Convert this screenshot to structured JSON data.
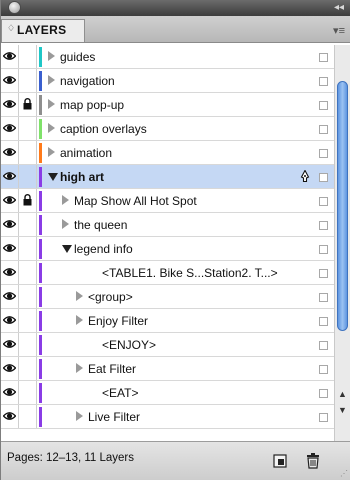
{
  "panel": {
    "tab_label": "LAYERS",
    "tab_arrows": "♢",
    "menu_icon": "▾≡",
    "collapse_icon": "◂◂"
  },
  "colors": {
    "selected_row": "#c5d8f4",
    "scroll_thumb": "#6b9fe6"
  },
  "rows": [
    {
      "name": "guides",
      "level": 0,
      "expand": "right",
      "eye": true,
      "lock": false,
      "color": "#1fc7c7",
      "bold": false,
      "selected": false,
      "pen": false
    },
    {
      "name": "navigation",
      "level": 0,
      "expand": "right",
      "eye": true,
      "lock": false,
      "color": "#3a5fcf",
      "bold": false,
      "selected": false,
      "pen": false
    },
    {
      "name": "map pop-up",
      "level": 0,
      "expand": "right",
      "eye": true,
      "lock": true,
      "color": "#8e8e8e",
      "bold": false,
      "selected": false,
      "pen": false
    },
    {
      "name": "caption overlays",
      "level": 0,
      "expand": "right",
      "eye": true,
      "lock": false,
      "color": "#7fe26a",
      "bold": false,
      "selected": false,
      "pen": false
    },
    {
      "name": "animation",
      "level": 0,
      "expand": "right",
      "eye": true,
      "lock": false,
      "color": "#ff7a1a",
      "bold": false,
      "selected": false,
      "pen": false
    },
    {
      "name": "high art",
      "level": 0,
      "expand": "down",
      "eye": true,
      "lock": false,
      "color": "#8a3ce6",
      "bold": true,
      "selected": true,
      "pen": true
    },
    {
      "name": "Map Show All Hot Spot",
      "level": 1,
      "expand": "right",
      "eye": true,
      "lock": true,
      "color": "#8a3ce6",
      "bold": false,
      "selected": false,
      "pen": false
    },
    {
      "name": "the queen",
      "level": 1,
      "expand": "right",
      "eye": true,
      "lock": false,
      "color": "#8a3ce6",
      "bold": false,
      "selected": false,
      "pen": false
    },
    {
      "name": "legend info",
      "level": 1,
      "expand": "down",
      "eye": true,
      "lock": false,
      "color": "#8a3ce6",
      "bold": false,
      "selected": false,
      "pen": false
    },
    {
      "name": "<TABLE1. Bike S...Station2. T...>",
      "level": 3,
      "expand": "none",
      "eye": true,
      "lock": false,
      "color": "#8a3ce6",
      "bold": false,
      "selected": false,
      "pen": false
    },
    {
      "name": "<group>",
      "level": 2,
      "expand": "right",
      "eye": true,
      "lock": false,
      "color": "#8a3ce6",
      "bold": false,
      "selected": false,
      "pen": false
    },
    {
      "name": "Enjoy Filter",
      "level": 2,
      "expand": "right",
      "eye": true,
      "lock": false,
      "color": "#8a3ce6",
      "bold": false,
      "selected": false,
      "pen": false
    },
    {
      "name": "<ENJOY>",
      "level": 3,
      "expand": "none",
      "eye": true,
      "lock": false,
      "color": "#8a3ce6",
      "bold": false,
      "selected": false,
      "pen": false
    },
    {
      "name": "Eat Filter",
      "level": 2,
      "expand": "right",
      "eye": true,
      "lock": false,
      "color": "#8a3ce6",
      "bold": false,
      "selected": false,
      "pen": false
    },
    {
      "name": "<EAT>",
      "level": 3,
      "expand": "none",
      "eye": true,
      "lock": false,
      "color": "#8a3ce6",
      "bold": false,
      "selected": false,
      "pen": false
    },
    {
      "name": "Live Filter",
      "level": 2,
      "expand": "right",
      "eye": true,
      "lock": false,
      "color": "#8a3ce6",
      "bold": false,
      "selected": false,
      "pen": false
    }
  ],
  "scrollbar": {
    "up_arrow": "▲",
    "down_arrow": "▼"
  },
  "status": {
    "text": "Pages: 12–13, 11 Layers"
  },
  "icons": {
    "visibility": "eye-icon",
    "lock": "lock-icon",
    "pen": "pen-icon",
    "new_layer": "new-layer-icon",
    "delete": "trash-icon"
  }
}
